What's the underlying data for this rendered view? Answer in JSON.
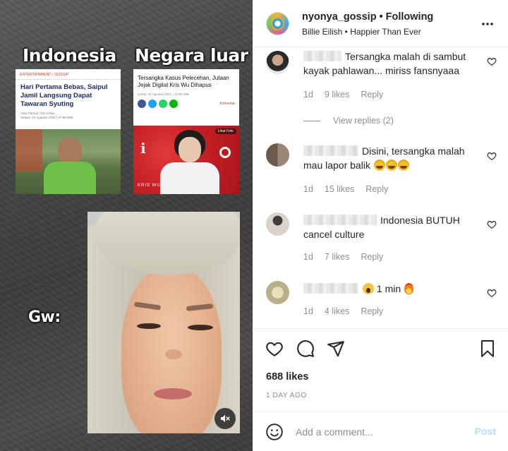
{
  "media": {
    "label_left": "Indonesia",
    "label_right": "Negara luar",
    "label_gw": "Gw:",
    "card_left": {
      "tag": "ENTERTAINMENT / GOSSIP",
      "headline": "Hari Pertama Bebas, Saipul Jamil Langsung Dapat Tawaran Syuting",
      "byline": "Yasir Fareuk | Evi Arlinie",
      "date": "Selasa, 24 Agustus 2021 | 07:58 WIB"
    },
    "card_right": {
      "headline": "Tersangka Kasus Pelecehan, Jutaan Jejak Digital Kris Wu Dihapus",
      "date": "Jumat, 20 Agustus 2021 | 12:35 WIB",
      "komentar": "Komentar",
      "lihat_foto": "Lihat Foto",
      "watermark": "KRIS WU"
    },
    "mute_icon": "speaker-mute-icon"
  },
  "header": {
    "username": "nyonya_gossip",
    "separator": "•",
    "follow_status": "Following",
    "audio": "Billie Eilish • Happier Than Ever",
    "more_icon": "more-horizontal-icon"
  },
  "comments": [
    {
      "text": "Tersangka malah di sambut kayak pahlawan... miriss fansnyaaa",
      "time": "1d",
      "likes": "9 likes",
      "reply": "Reply",
      "view_replies": "View replies (2)"
    },
    {
      "text": "Disini, tersangka malah mau lapor balik",
      "emojis": [
        "face-with-tears-of-joy",
        "face-with-tears-of-joy",
        "face-with-tears-of-joy"
      ],
      "time": "1d",
      "likes": "15 likes",
      "reply": "Reply"
    },
    {
      "text": "Indonesia BUTUH cancel culture",
      "time": "1d",
      "likes": "7 likes",
      "reply": "Reply"
    },
    {
      "text": "1 min",
      "emojis": [
        "face-screaming-in-fear",
        "fire"
      ],
      "time": "1d",
      "likes": "4 likes",
      "reply": "Reply"
    }
  ],
  "actions": {
    "like_icon": "heart-icon",
    "comment_icon": "comment-bubble-icon",
    "share_icon": "paper-plane-icon",
    "save_icon": "bookmark-icon",
    "likes": "688 likes",
    "time": "1 DAY AGO"
  },
  "comment_box": {
    "placeholder": "Add a comment...",
    "post_label": "Post",
    "emoji_icon": "smiley-icon"
  },
  "colors": {
    "text": "#262626",
    "secondary": "#8e8e8e",
    "post_disabled": "#b2dffc",
    "divider": "#efefef"
  }
}
